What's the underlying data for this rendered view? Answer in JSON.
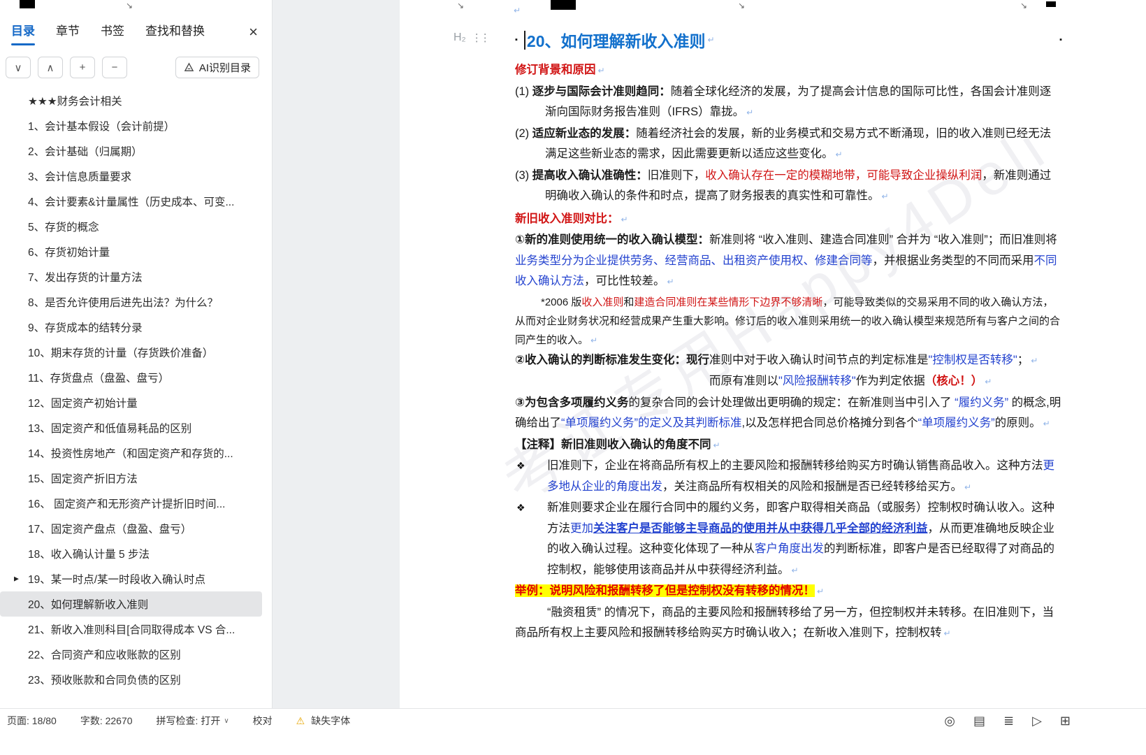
{
  "icons": {
    "close": "×",
    "chevron_down": "∨",
    "chevron_up": "∧",
    "plus": "+",
    "minus": "−",
    "expand": "▶",
    "bullet": "❖",
    "pmark": "↵",
    "warning": "⚠",
    "caret_down": "∨",
    "resize": "↘",
    "h2": "H₂",
    "drag": "⋮⋮",
    "square": "▪"
  },
  "colors": {
    "accent_blue": "#1569c7",
    "doc_heading_blue": "#1270cc",
    "doc_link_blue": "#2443cf",
    "red": "#d11515",
    "highlight_yellow": "#ffff00",
    "selected_item_bg": "#e4e5e7"
  },
  "sidebar": {
    "tabs": [
      {
        "id": "toc",
        "label": "目录",
        "active": true
      },
      {
        "id": "chapters",
        "label": "章节",
        "active": false
      },
      {
        "id": "bookmarks",
        "label": "书签",
        "active": false
      },
      {
        "id": "find-replace",
        "label": "查找和替换",
        "active": false
      }
    ],
    "ai_button_label": "AI识别目录",
    "items": [
      {
        "label": "★★★财务会计相关"
      },
      {
        "label": "1、会计基本假设（会计前提）"
      },
      {
        "label": "2、会计基础（归属期）"
      },
      {
        "label": "3、会计信息质量要求"
      },
      {
        "label": "4、会计要素&计量属性（历史成本、可变..."
      },
      {
        "label": "5、存货的概念"
      },
      {
        "label": "6、存货初始计量"
      },
      {
        "label": "7、发出存货的计量方法"
      },
      {
        "label": "8、是否允许使用后进先出法？为什么？"
      },
      {
        "label": "9、存货成本的结转分录"
      },
      {
        "label": "10、期末存货的计量（存货跌价准备）"
      },
      {
        "label": "11、存货盘点（盘盈、盘亏）"
      },
      {
        "label": "12、固定资产初始计量"
      },
      {
        "label": "13、固定资产和低值易耗品的区别"
      },
      {
        "label": "14、投资性房地产（和固定资产和存货的..."
      },
      {
        "label": "15、固定资产折旧方法"
      },
      {
        "label": "16、 固定资产和无形资产计提折旧时间..."
      },
      {
        "label": "17、固定资产盘点（盘盈、盘亏）"
      },
      {
        "label": "18、收入确认计量 5 步法"
      },
      {
        "label": "19、某一时点/某一时段收入确认时点",
        "expandable": true
      },
      {
        "label": "20、如何理解新收入准则",
        "selected": true
      },
      {
        "label": "21、新收入准则科目[合同取得成本 VS 合..."
      },
      {
        "label": "22、合同资产和应收账款的区别"
      },
      {
        "label": "23、预收账款和合同负债的区别"
      }
    ]
  },
  "doc": {
    "heading": "20、如何理解新收入准则",
    "watermark": "考证专用Happy4Deli",
    "paragraphs": [
      {
        "cls": "red-line",
        "segments": [
          {
            "t": "修订背景和原因",
            "s": "rb"
          }
        ]
      },
      {
        "cls": "num",
        "segments": [
          {
            "t": "(1)  ",
            "s": "n"
          },
          {
            "t": "逐步与国际会计准则趋同：",
            "s": "b"
          },
          {
            "t": "随着全球化经济的发展，为了提高会计信息的国际可比性，各国会计准则逐渐向国际财务报告准则（IFRS）靠拢。",
            "s": "n"
          }
        ]
      },
      {
        "cls": "num",
        "segments": [
          {
            "t": "(2)  ",
            "s": "n"
          },
          {
            "t": "适应新业态的发展：",
            "s": "b"
          },
          {
            "t": "随着经济社会的发展，新的业务模式和交易方式不断涌现，旧的收入准则已经无法满足这些新业态的需求，因此需要更新以适应这些变化。",
            "s": "n"
          }
        ]
      },
      {
        "cls": "num",
        "segments": [
          {
            "t": "(3)  ",
            "s": "n"
          },
          {
            "t": "提高收入确认准确性：",
            "s": "b"
          },
          {
            "t": "旧准则下，",
            "s": "n"
          },
          {
            "t": "收入确认存在一定的模糊地带，可能导致企业操纵利润",
            "s": "r"
          },
          {
            "t": "，新准则通过明确收入确认的条件和时点，提高了财务报表的真实性和可靠性。",
            "s": "n"
          }
        ]
      },
      {
        "cls": "red-line",
        "segments": [
          {
            "t": "新旧收入准则对比：",
            "s": "rb"
          }
        ]
      },
      {
        "cls": "plain",
        "segments": [
          {
            "t": "①新的准则使用统一的收入确认模型：",
            "s": "b"
          },
          {
            "t": "新准则将 “收入准则、建造合同准则” 合并为 “收入准则”；而旧准则将",
            "s": "n"
          },
          {
            "t": "业务类型分为企业提供劳务、经营商品、出租资产使用权、修建合同等",
            "s": "bl"
          },
          {
            "t": "，并根据业务类型的不同而采用",
            "s": "n"
          },
          {
            "t": "不同收入确认方法",
            "s": "bl"
          },
          {
            "t": "，可比性较差。",
            "s": "n"
          }
        ]
      },
      {
        "cls": "note",
        "segments": [
          {
            "t": "*2006 版",
            "s": "n"
          },
          {
            "t": "收入准则",
            "s": "r"
          },
          {
            "t": "和",
            "s": "n"
          },
          {
            "t": "建造合同准则在某些情形下边界不够清晰",
            "s": "r"
          },
          {
            "t": "，可能导致类似的交易采用不同的收入确认方法，从而对企业财务状况和经营成果产生重大影响。修订后的收入准则采用统一的收入确认模型来规范所有与客户之间的合同产生的收入。",
            "s": "n"
          }
        ]
      },
      {
        "cls": "plain",
        "segments": [
          {
            "t": "②收入确认的判断标准发生变化：",
            "s": "b"
          },
          {
            "t": "现行",
            "s": "b"
          },
          {
            "t": "准则中对于收入确认时间节点的判定标准是",
            "s": "n"
          },
          {
            "t": "\"控制权是否转移\"",
            "s": "bl"
          },
          {
            "t": "；",
            "s": "n"
          }
        ]
      },
      {
        "cls": "indent-right",
        "segments": [
          {
            "t": "而原有准则以",
            "s": "n"
          },
          {
            "t": "\"风险报酬转移\"",
            "s": "bl"
          },
          {
            "t": "作为判定依据",
            "s": "n"
          },
          {
            "t": "（核心！）",
            "s": "rb"
          }
        ]
      },
      {
        "cls": "plain",
        "segments": [
          {
            "t": "③为包含多项履约义务",
            "s": "b"
          },
          {
            "t": "的复杂合同的会计处理做出更明确的规定：在新准则当中引入了 ",
            "s": "n"
          },
          {
            "t": "“履约义务”",
            "s": "bl"
          },
          {
            "t": " 的概念,明确给出了",
            "s": "n"
          },
          {
            "t": "“单项履约义务”的定义及其判断标准",
            "s": "bl"
          },
          {
            "t": ",以及怎样把合同总价格摊分到各个",
            "s": "n"
          },
          {
            "t": "“单项履约义务”",
            "s": "bl"
          },
          {
            "t": "的原则。",
            "s": "n"
          }
        ]
      },
      {
        "cls": "plain",
        "segments": [
          {
            "t": "【注释】新旧准则收入确认的角度不同",
            "s": "b"
          }
        ]
      },
      {
        "cls": "bullet",
        "segments": [
          {
            "t": "旧准则下，企业在将商品所有权上的主要风险和报酬转移给购买方时确认销售商品收入。这种方法",
            "s": "n"
          },
          {
            "t": "更多地从企业的角度出发",
            "s": "bl"
          },
          {
            "t": "，关注商品所有权相关的风险和报酬是否已经转移给买方。",
            "s": "n"
          }
        ]
      },
      {
        "cls": "bullet",
        "segments": [
          {
            "t": "新准则要求企业在履行合同中的履约义务，即客户取得相关商品（或服务）控制权时确认收入。这种方法",
            "s": "n"
          },
          {
            "t": "更加",
            "s": "bl"
          },
          {
            "t": "关注客户是否能够主导商品的使用并从中获得几乎全部的经济利益",
            "s": "blb"
          },
          {
            "t": "，从而更准确地反映企业的收入确认过程。这种变化体现了一种从",
            "s": "n"
          },
          {
            "t": "客户角度出发",
            "s": "bl"
          },
          {
            "t": "的判断标准，即客户是否已经取得了对商品的控制权，能够使用该商品并从中获得经济利益。",
            "s": "n"
          }
        ]
      },
      {
        "cls": "plain",
        "segments": [
          {
            "t": "举例：说明风险和报酬转移了但是控制权没有转移的情况！",
            "s": "hl"
          }
        ]
      },
      {
        "cls": "first-indent",
        "segments": [
          {
            "t": "“融资租赁” 的情况下，商品的主要风险和报酬转移给了另一方，但控制权并未转移。在旧准则下，当商品所有权上主要风险和报酬转移给购买方时确认收入；在新收入准则下，控制权转",
            "s": "n"
          }
        ]
      }
    ]
  },
  "statusbar": {
    "page": "页面: 18/80",
    "words": "字数: 22670",
    "spellcheck": "拼写检查: 打开",
    "proofread": "校对",
    "missing_font": "缺失字体",
    "icons": [
      {
        "name": "eye-icon",
        "glyph": "◎"
      },
      {
        "name": "document-icon",
        "glyph": "▤"
      },
      {
        "name": "outline-list-icon",
        "glyph": "≣"
      },
      {
        "name": "play-presentation-icon",
        "glyph": "▷"
      },
      {
        "name": "grid-view-icon",
        "glyph": "⊞"
      }
    ]
  }
}
